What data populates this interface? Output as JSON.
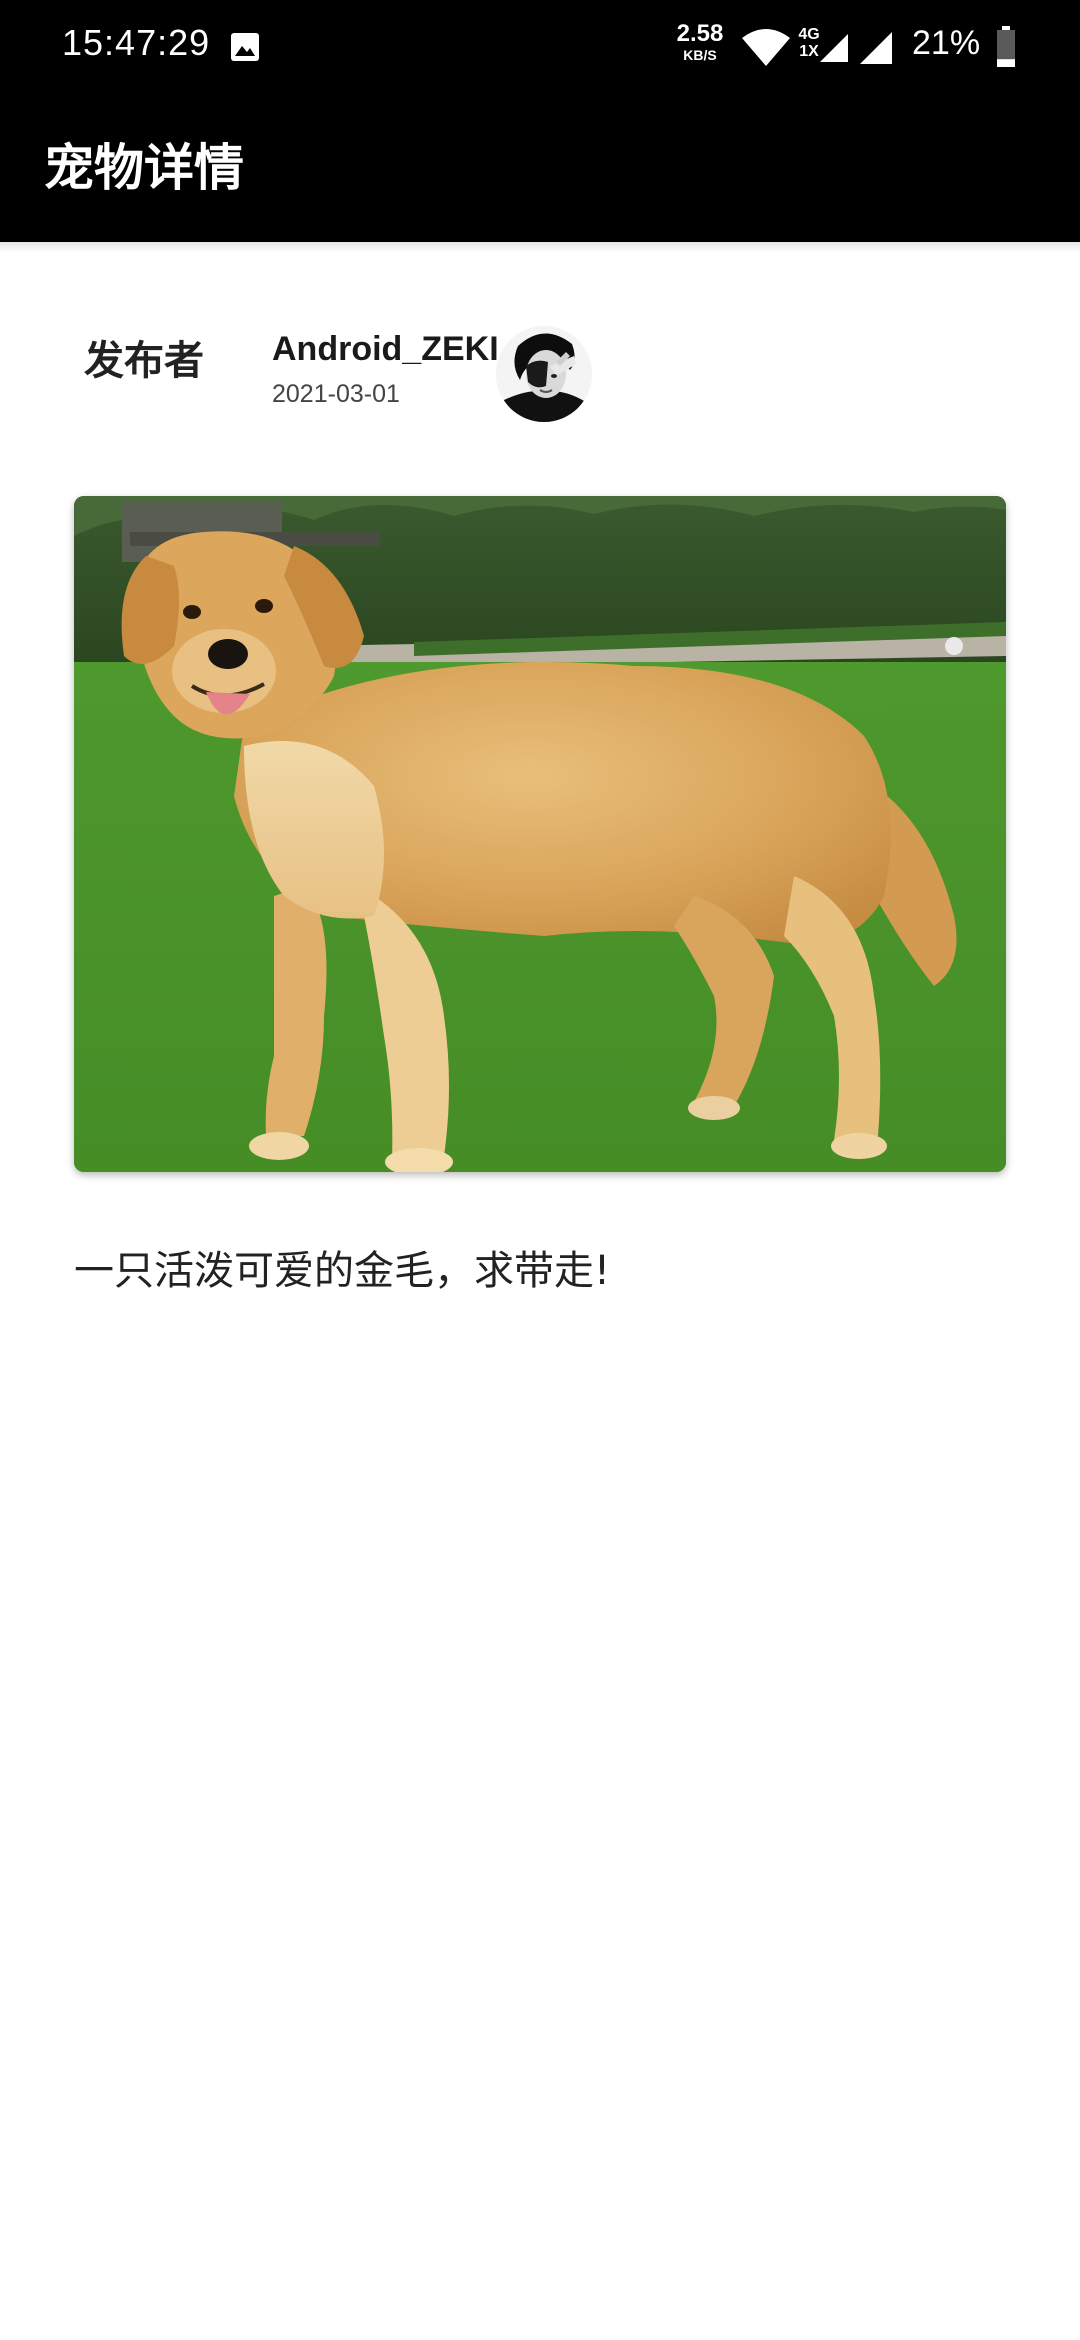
{
  "status_bar": {
    "time": "15:47:29",
    "net_speed_value": "2.58",
    "net_speed_unit": "KB/S",
    "network_type": "4G",
    "network_sub": "1X",
    "battery_percent": "21%",
    "battery_level": 0.21,
    "icons": [
      "gallery-icon",
      "wifi-icon",
      "cellular-signal-icon",
      "cellular-signal-icon",
      "battery-icon"
    ]
  },
  "app_bar": {
    "title": "宠物详情"
  },
  "publisher": {
    "label": "发布者",
    "name": "Android_ZEKI",
    "date": "2021-03-01"
  },
  "pet": {
    "photo_subject": "golden-retriever",
    "description": "一只活泼可爱的金毛，求带走!"
  },
  "colors": {
    "app_bar_bg": "#000000",
    "app_bar_text": "#ffffff",
    "page_bg": "#ffffff",
    "primary_text": "#222222",
    "secondary_text": "#444444"
  }
}
